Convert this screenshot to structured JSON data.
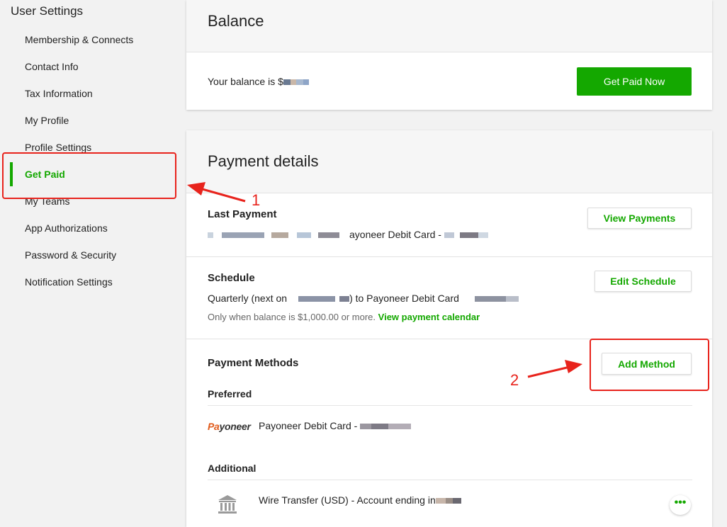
{
  "sidebar": {
    "title": "User Settings",
    "items": [
      {
        "label": "Membership & Connects"
      },
      {
        "label": "Contact Info"
      },
      {
        "label": "Tax Information"
      },
      {
        "label": "My Profile"
      },
      {
        "label": "Profile Settings"
      },
      {
        "label": "Get Paid",
        "active": true
      },
      {
        "label": "My Teams"
      },
      {
        "label": "App Authorizations"
      },
      {
        "label": "Password & Security"
      },
      {
        "label": "Notification Settings"
      }
    ]
  },
  "balance": {
    "title": "Balance",
    "text": "Your balance is $",
    "get_paid_now_label": "Get Paid Now"
  },
  "payment_details": {
    "title": "Payment details",
    "last_payment": {
      "heading": "Last Payment",
      "text": "ayoneer Debit Card -",
      "view_payments_label": "View Payments"
    },
    "schedule": {
      "heading": "Schedule",
      "line_prefix": "Quarterly (next on",
      "line_suffix": ") to Payoneer Debit Card",
      "note": "Only when balance is $1,000.00 or more.",
      "calendar_link": "View payment calendar",
      "edit_schedule_label": "Edit Schedule"
    },
    "methods": {
      "heading": "Payment Methods",
      "add_method_label": "Add Method",
      "preferred_label": "Preferred",
      "preferred_logo": "Payoneer",
      "preferred_method": "Payoneer Debit Card -",
      "additional_label": "Additional",
      "additional_method": "Wire Transfer (USD) - Account ending in",
      "more_label": "•••"
    }
  },
  "annotations": {
    "one": "1",
    "two": "2",
    "color": "#e8231c"
  },
  "colors": {
    "accent": "#14a800",
    "page_bg": "#f2f2f2"
  },
  "icons": {
    "bank": "bank-icon",
    "more": "more-options-icon"
  }
}
